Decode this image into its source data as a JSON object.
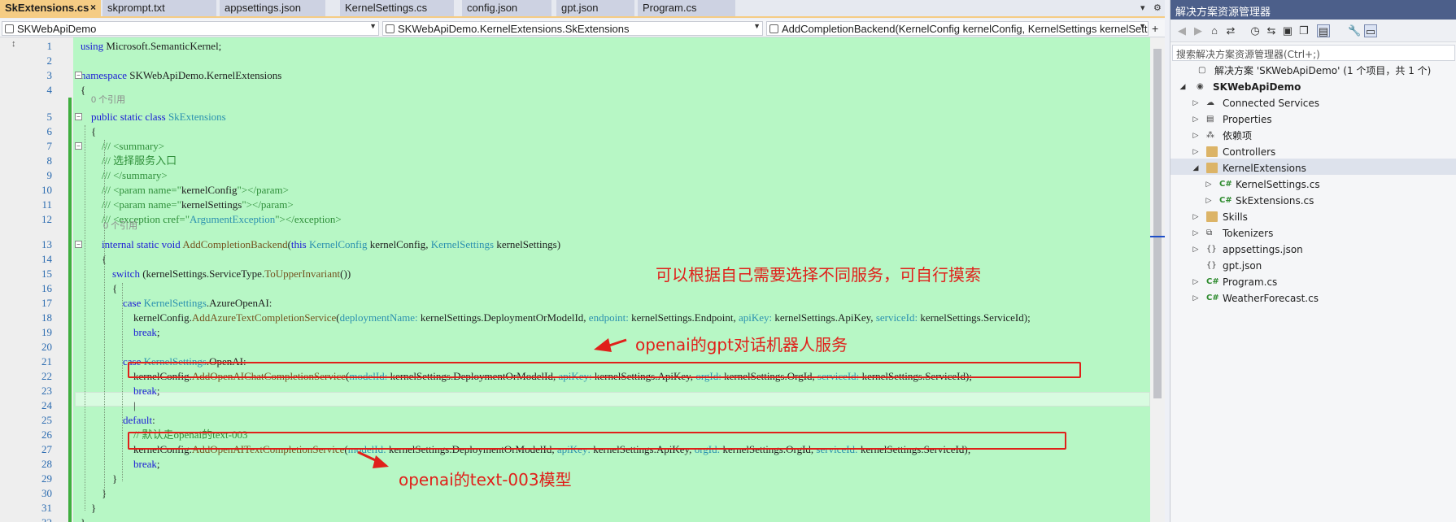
{
  "tabs": [
    {
      "label": "SkExtensions.cs",
      "active": true
    },
    {
      "label": "skprompt.txt"
    },
    {
      "label": "appsettings.json"
    },
    {
      "label": "KernelSettings.cs"
    },
    {
      "label": "config.json"
    },
    {
      "label": "gpt.json"
    },
    {
      "label": "Program.cs"
    }
  ],
  "tab_close": "×",
  "navbar": {
    "project": "SKWebApiDemo",
    "class": "SKWebApiDemo.KernelExtensions.SkExtensions",
    "member": "AddCompletionBackend(KernelConfig kernelConfig, KernelSettings kernelSettings)"
  },
  "code_lines": [
    {
      "n": "1",
      "t": [
        {
          "c": "kw",
          "x": "using"
        },
        {
          "x": " Microsoft.SemanticKernel;"
        }
      ]
    },
    {
      "n": "2",
      "t": []
    },
    {
      "n": "3",
      "t": [
        {
          "c": "kw",
          "x": "namespace"
        },
        {
          "x": " SKWebApiDemo.KernelExtensions"
        }
      ]
    },
    {
      "n": "4",
      "t": [
        {
          "x": "{"
        }
      ]
    },
    {
      "n": "5",
      "t": [
        {
          "x": "    "
        },
        {
          "c": "kw",
          "x": "public static class"
        },
        {
          "x": " "
        },
        {
          "c": "ty",
          "x": "SkExtensions"
        }
      ]
    },
    {
      "n": "6",
      "t": [
        {
          "x": "    {"
        }
      ]
    },
    {
      "n": "7",
      "t": [
        {
          "x": "        "
        },
        {
          "c": "cm",
          "x": "/// <summary>"
        }
      ]
    },
    {
      "n": "8",
      "t": [
        {
          "x": "        "
        },
        {
          "c": "cm",
          "x": "/// 选择服务入口"
        }
      ]
    },
    {
      "n": "9",
      "t": [
        {
          "x": "        "
        },
        {
          "c": "cm",
          "x": "/// </summary>"
        }
      ]
    },
    {
      "n": "10",
      "t": [
        {
          "x": "        "
        },
        {
          "c": "cm",
          "x": "/// <param name=\""
        },
        {
          "x": "kernelConfig"
        },
        {
          "c": "cm",
          "x": "\"></param>"
        }
      ]
    },
    {
      "n": "11",
      "t": [
        {
          "x": "        "
        },
        {
          "c": "cm",
          "x": "/// <param name=\""
        },
        {
          "x": "kernelSettings"
        },
        {
          "c": "cm",
          "x": "\"></param>"
        }
      ]
    },
    {
      "n": "12",
      "t": [
        {
          "x": "        "
        },
        {
          "c": "cm",
          "x": "/// <exception cref=\""
        },
        {
          "c": "ty",
          "x": "ArgumentException"
        },
        {
          "c": "cm",
          "x": "\"></exception>"
        }
      ]
    },
    {
      "n": "13",
      "t": [
        {
          "x": "        "
        },
        {
          "c": "kw",
          "x": "internal static void"
        },
        {
          "x": " "
        },
        {
          "c": "me",
          "x": "AddCompletionBackend"
        },
        {
          "x": "("
        },
        {
          "c": "kw",
          "x": "this"
        },
        {
          "x": " "
        },
        {
          "c": "ty",
          "x": "KernelConfig"
        },
        {
          "x": " kernelConfig, "
        },
        {
          "c": "ty",
          "x": "KernelSettings"
        },
        {
          "x": " kernelSettings)"
        }
      ]
    },
    {
      "n": "14",
      "t": [
        {
          "x": "        {"
        }
      ]
    },
    {
      "n": "15",
      "t": [
        {
          "x": "            "
        },
        {
          "c": "kw",
          "x": "switch"
        },
        {
          "x": " (kernelSettings.ServiceType."
        },
        {
          "c": "me",
          "x": "ToUpperInvariant"
        },
        {
          "x": "())"
        }
      ]
    },
    {
      "n": "16",
      "t": [
        {
          "x": "            {"
        }
      ]
    },
    {
      "n": "17",
      "t": [
        {
          "x": "                "
        },
        {
          "c": "kw",
          "x": "case"
        },
        {
          "x": " "
        },
        {
          "c": "ty",
          "x": "KernelSettings"
        },
        {
          "x": ".AzureOpenAI:"
        }
      ]
    },
    {
      "n": "18",
      "t": [
        {
          "x": "                    kernelConfig."
        },
        {
          "c": "me",
          "x": "AddAzureTextCompletionService"
        },
        {
          "x": "("
        },
        {
          "c": "ty",
          "x": "deploymentName:"
        },
        {
          "x": " kernelSettings.DeploymentOrModelId, "
        },
        {
          "c": "ty",
          "x": "endpoint:"
        },
        {
          "x": " kernelSettings.Endpoint, "
        },
        {
          "c": "ty",
          "x": "apiKey:"
        },
        {
          "x": " kernelSettings.ApiKey, "
        },
        {
          "c": "ty",
          "x": "serviceId:"
        },
        {
          "x": " kernelSettings.ServiceId);"
        }
      ]
    },
    {
      "n": "19",
      "t": [
        {
          "x": "                    "
        },
        {
          "c": "kw",
          "x": "break"
        },
        {
          "x": ";"
        }
      ]
    },
    {
      "n": "20",
      "t": []
    },
    {
      "n": "21",
      "t": [
        {
          "x": "                "
        },
        {
          "c": "kw",
          "x": "case"
        },
        {
          "x": " "
        },
        {
          "c": "ty",
          "x": "KernelSettings"
        },
        {
          "x": ".OpenAI:"
        }
      ]
    },
    {
      "n": "22",
      "t": [
        {
          "x": "                    kernelConfig."
        },
        {
          "c": "me",
          "x": "AddOpenAIChatCompletionService"
        },
        {
          "x": "("
        },
        {
          "c": "ty",
          "x": "modelId:"
        },
        {
          "x": " kernelSettings.DeploymentOrModelId, "
        },
        {
          "c": "ty",
          "x": "apiKey:"
        },
        {
          "x": " kernelSettings.ApiKey, "
        },
        {
          "c": "ty",
          "x": "orgId:"
        },
        {
          "x": " kernelSettings.OrgId, "
        },
        {
          "c": "ty",
          "x": "serviceId:"
        },
        {
          "x": " kernelSettings.ServiceId);"
        }
      ]
    },
    {
      "n": "23",
      "t": [
        {
          "x": "                    "
        },
        {
          "c": "kw",
          "x": "break"
        },
        {
          "x": ";"
        }
      ]
    },
    {
      "n": "24",
      "t": [
        {
          "x": "                    |"
        }
      ]
    },
    {
      "n": "25",
      "t": [
        {
          "x": "                "
        },
        {
          "c": "kw",
          "x": "default"
        },
        {
          "x": ":"
        }
      ]
    },
    {
      "n": "26",
      "t": [
        {
          "x": "                    "
        },
        {
          "c": "cm",
          "x": "// 默认走openai的text-003"
        }
      ]
    },
    {
      "n": "27",
      "t": [
        {
          "x": "                    kernelConfig."
        },
        {
          "c": "me",
          "x": "AddOpenAITextCompletionService"
        },
        {
          "x": "("
        },
        {
          "c": "ty",
          "x": "modelId:"
        },
        {
          "x": " kernelSettings.DeploymentOrModelId, "
        },
        {
          "c": "ty",
          "x": "apiKey:"
        },
        {
          "x": " kernelSettings.ApiKey, "
        },
        {
          "c": "ty",
          "x": "orgId:"
        },
        {
          "x": " kernelSettings.OrgId, "
        },
        {
          "c": "ty",
          "x": "serviceId:"
        },
        {
          "x": " kernelSettings.ServiceId);"
        }
      ]
    },
    {
      "n": "28",
      "t": [
        {
          "x": "                    "
        },
        {
          "c": "kw",
          "x": "break"
        },
        {
          "x": ";"
        }
      ]
    },
    {
      "n": "29",
      "t": [
        {
          "x": "            }"
        }
      ]
    },
    {
      "n": "30",
      "t": [
        {
          "x": "        }"
        }
      ]
    },
    {
      "n": "31",
      "t": [
        {
          "x": "    }"
        }
      ]
    },
    {
      "n": "32",
      "t": [
        {
          "x": "}"
        }
      ]
    }
  ],
  "ref_hints": {
    "class": "0 个引用",
    "method": "0 个引用"
  },
  "annotations": {
    "note1": "可以根据自己需要选择不同服务，可自行摸索",
    "note2": "openai的gpt对话机器人服务",
    "note3": "openai的text-003模型"
  },
  "solution_explorer": {
    "title": "解决方案资源管理器",
    "search_placeholder": "搜索解决方案资源管理器(Ctrl+;)",
    "items": [
      {
        "label": "解决方案 'SKWebApiDemo' (1 个项目，共 1 个)",
        "icon": "solution-icon",
        "level": 0,
        "arrow": ""
      },
      {
        "label": "SKWebApiDemo",
        "icon": "project-icon",
        "level": 0,
        "arrow": "◢",
        "bold": true
      },
      {
        "label": "Connected Services",
        "icon": "connected-services-icon",
        "level": 1,
        "arrow": "▷"
      },
      {
        "label": "Properties",
        "icon": "properties-icon",
        "level": 1,
        "arrow": "▷"
      },
      {
        "label": "依赖项",
        "icon": "dependencies-icon",
        "level": 1,
        "arrow": "▷"
      },
      {
        "label": "Controllers",
        "icon": "folder-icon",
        "level": 1,
        "arrow": "▷"
      },
      {
        "label": "KernelExtensions",
        "icon": "folder-icon",
        "level": 1,
        "arrow": "◢"
      },
      {
        "label": "KernelSettings.cs",
        "icon": "csharp-file-icon",
        "level": 2,
        "arrow": "▷"
      },
      {
        "label": "SkExtensions.cs",
        "icon": "csharp-file-icon",
        "level": 2,
        "arrow": "▷",
        "selected": true
      },
      {
        "label": "Skills",
        "icon": "folder-icon",
        "level": 1,
        "arrow": "▷"
      },
      {
        "label": "Tokenizers",
        "icon": "tokenizers-icon",
        "level": 1,
        "arrow": "▷"
      },
      {
        "label": "appsettings.json",
        "icon": "json-file-icon",
        "level": 1,
        "arrow": "▷"
      },
      {
        "label": "gpt.json",
        "icon": "json-file-icon",
        "level": 1,
        "arrow": ""
      },
      {
        "label": "Program.cs",
        "icon": "csharp-file-icon",
        "level": 1,
        "arrow": "▷"
      },
      {
        "label": "WeatherForecast.cs",
        "icon": "csharp-file-icon",
        "level": 1,
        "arrow": "▷"
      }
    ]
  },
  "colors": {
    "editor_bg": "#b7f7c5",
    "annotation": "#e0201a",
    "active_tab": "#f5cc84",
    "explorer_title": "#4c5f8a"
  }
}
